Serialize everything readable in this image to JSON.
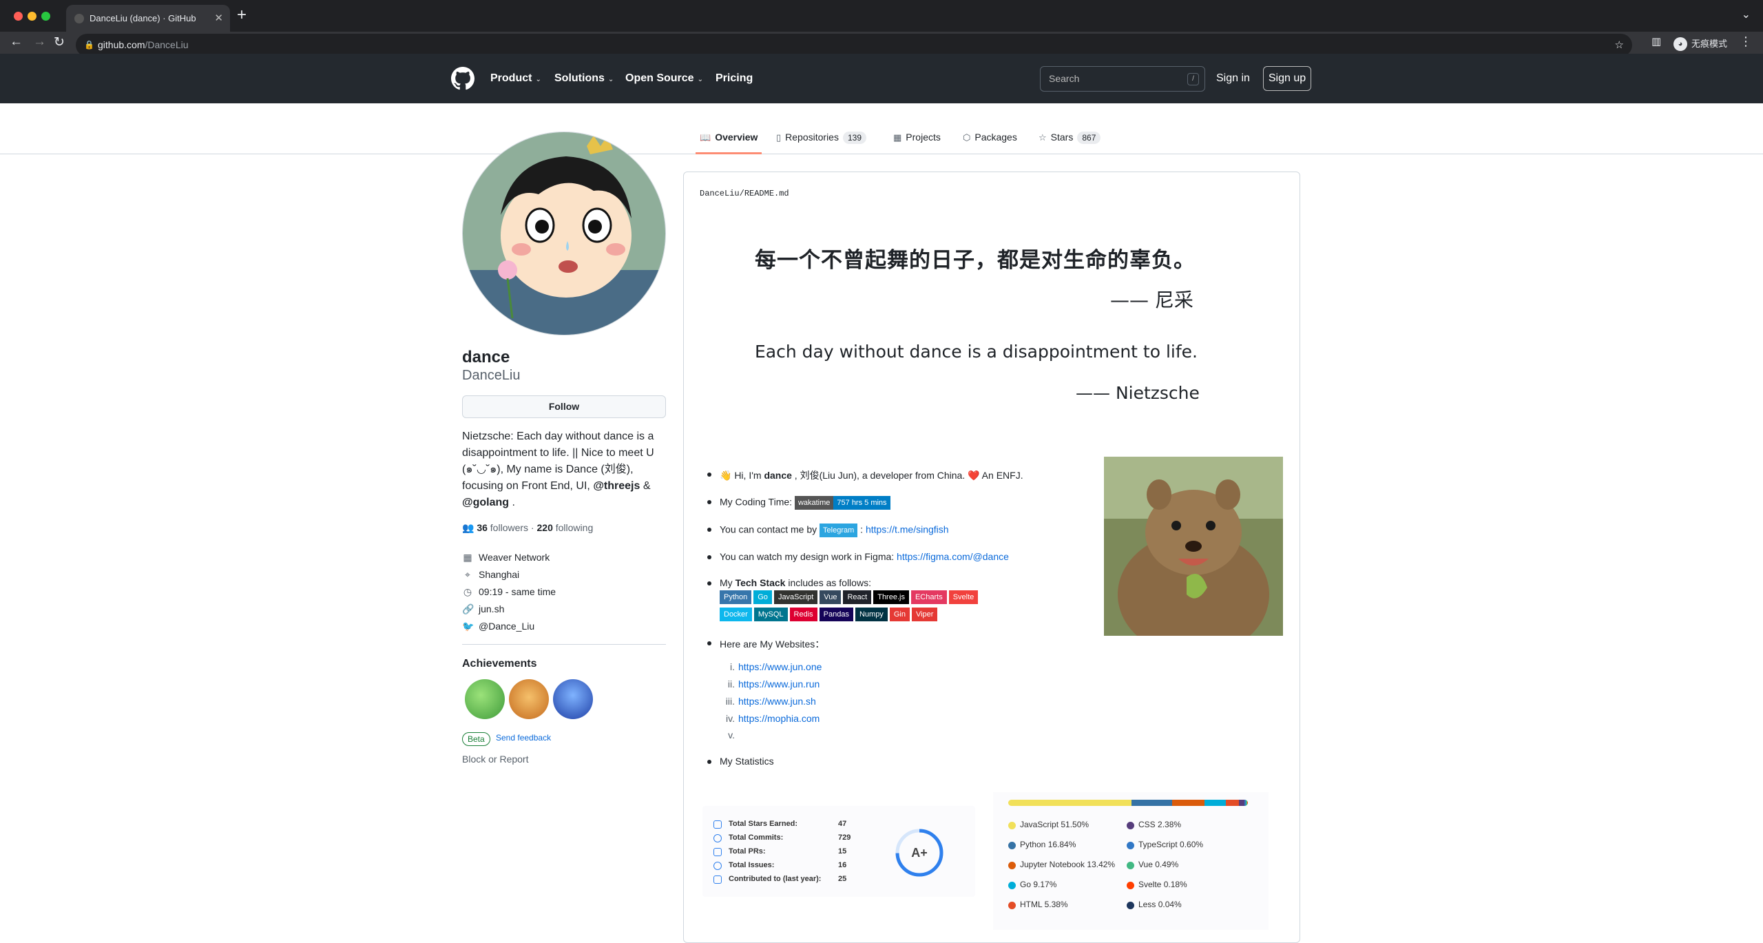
{
  "browser": {
    "tab_title": "DanceLiu (dance) · GitHub",
    "url_domain": "github.com",
    "url_path": "/DanceLiu",
    "incognito_label": "无痕模式"
  },
  "header": {
    "nav": [
      "Product",
      "Solutions",
      "Open Source",
      "Pricing"
    ],
    "search_placeholder": "Search",
    "search_shortcut": "/",
    "signin": "Sign in",
    "signup": "Sign up"
  },
  "tabs": [
    {
      "label": "Overview",
      "icon": "book-icon"
    },
    {
      "label": "Repositories",
      "count": "139",
      "icon": "repo-icon"
    },
    {
      "label": "Projects",
      "icon": "table-icon"
    },
    {
      "label": "Packages",
      "icon": "package-icon"
    },
    {
      "label": "Stars",
      "count": "867",
      "icon": "star-icon"
    }
  ],
  "profile": {
    "name": "dance",
    "login": "DanceLiu",
    "follow_label": "Follow",
    "bio_pre": "Nietzsche: Each day without dance is a disappointment to life. || Nice to meet U (๑˘◡˘๑), My name is Dance (刘俊), focusing on Front End, UI, ",
    "bio_org1": "@threejs",
    "bio_mid": " & ",
    "bio_org2": "@golang",
    "bio_end": " .",
    "followers": "36",
    "followers_label": "followers",
    "following": "220",
    "following_label": "following",
    "company": "Weaver Network",
    "location": "Shanghai",
    "localtime": "09:19 - same time",
    "website": "jun.sh",
    "twitter": "@Dance_Liu",
    "achievements_title": "Achievements",
    "beta": "Beta",
    "feedback": "Send feedback",
    "block": "Block or Report"
  },
  "readme": {
    "owner": "DanceLiu",
    "sep": "/",
    "file": "README.md",
    "quote_cn": "每一个不曾起舞的日子，都是对生命的辜负。",
    "author_cn": "—— 尼采",
    "quote_en": "Each day without dance is a disappointment to life.",
    "author_en": "—— Nietzsche",
    "hi_pre": "👋 Hi, I'm ",
    "hi_name": "dance",
    "hi_post": " , 刘俊(Liu Jun), a developer from China. ❤️ An ENFJ.",
    "coding_label": "My Coding Time:",
    "wakatime_left": "wakatime",
    "wakatime_right": "757 hrs 5 mins",
    "contact_label": "You can contact me by",
    "telegram_badge": "Telegram",
    "telegram_sep": " : ",
    "telegram_link": "https://t.me/singfish",
    "figma_label": "You can watch my design work in Figma: ",
    "figma_link": "https://figma.com/@dance",
    "stack_pre": "My ",
    "stack_bold": "Tech Stack",
    "stack_post": " includes as follows:",
    "stack": [
      {
        "name": "Python",
        "color": "#3776ab"
      },
      {
        "name": "Go",
        "color": "#00add8"
      },
      {
        "name": "JavaScript",
        "color": "#323330"
      },
      {
        "name": "Vue",
        "color": "#35495e"
      },
      {
        "name": "React",
        "color": "#20232a"
      },
      {
        "name": "Three.js",
        "color": "#000000"
      },
      {
        "name": "ECharts",
        "color": "#e43961"
      },
      {
        "name": "Svelte",
        "color": "#f1413d"
      },
      {
        "name": "Docker",
        "color": "#0db7ed"
      },
      {
        "name": "MySQL",
        "color": "#00758f"
      },
      {
        "name": "Redis",
        "color": "#dd0031"
      },
      {
        "name": "Pandas",
        "color": "#150458"
      },
      {
        "name": "Numpy",
        "color": "#013243"
      },
      {
        "name": "Gin",
        "color": "#e53935"
      },
      {
        "name": "Viper",
        "color": "#e53935"
      }
    ],
    "websites_label": "Here are My Websites：",
    "websites": [
      "https://www.jun.one",
      "https://www.jun.run",
      "https://www.jun.sh",
      "https://mophia.com",
      ""
    ],
    "website_nums": [
      "i.",
      "ii.",
      "iii.",
      "iv.",
      "v."
    ],
    "statistics_label": "My Statistics"
  },
  "stats": {
    "rows": [
      {
        "label": "Total Stars Earned:",
        "value": "47"
      },
      {
        "label": "Total Commits:",
        "value": "729"
      },
      {
        "label": "Total PRs:",
        "value": "15"
      },
      {
        "label": "Total Issues:",
        "value": "16"
      },
      {
        "label": "Contributed to (last year):",
        "value": "25"
      }
    ],
    "grade": "A+",
    "grade_color": "#2f80ed"
  },
  "languages": [
    {
      "name": "JavaScript",
      "pct": "51.50%",
      "value": 51.5,
      "color": "#f1e05a"
    },
    {
      "name": "CSS",
      "pct": "2.38%",
      "value": 2.38,
      "color": "#563d7c"
    },
    {
      "name": "Python",
      "pct": "16.84%",
      "value": 16.84,
      "color": "#3572a5"
    },
    {
      "name": "TypeScript",
      "pct": "0.60%",
      "value": 0.6,
      "color": "#3178c6"
    },
    {
      "name": "Jupyter Notebook",
      "pct": "13.42%",
      "value": 13.42,
      "color": "#da5b0b"
    },
    {
      "name": "Vue",
      "pct": "0.49%",
      "value": 0.49,
      "color": "#41b883"
    },
    {
      "name": "Go",
      "pct": "9.17%",
      "value": 9.17,
      "color": "#00add8"
    },
    {
      "name": "Svelte",
      "pct": "0.18%",
      "value": 0.18,
      "color": "#ff3e00"
    },
    {
      "name": "HTML",
      "pct": "5.38%",
      "value": 5.38,
      "color": "#e34c26"
    },
    {
      "name": "Less",
      "pct": "0.04%",
      "value": 0.04,
      "color": "#1d365d"
    }
  ]
}
